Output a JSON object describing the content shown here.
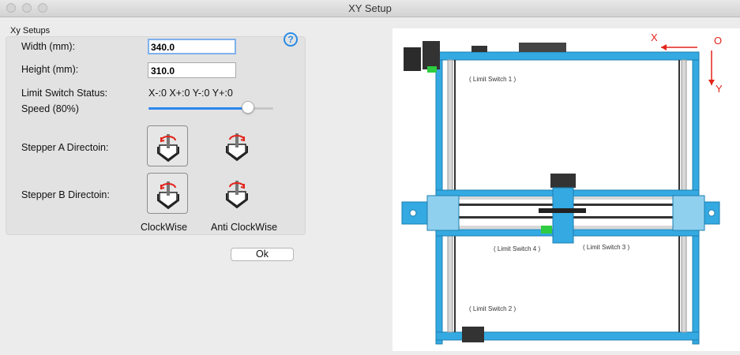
{
  "window": {
    "title": "XY Setup"
  },
  "group": {
    "label": "Xy Setups"
  },
  "help": {
    "symbol": "?"
  },
  "width": {
    "label": "Width (mm):",
    "value": "340.0"
  },
  "height": {
    "label": "Height (mm):",
    "value": "310.0"
  },
  "limit_switch": {
    "label": "Limit Switch Status:",
    "value": "X-:0 X+:0 Y-:0 Y+:0"
  },
  "speed": {
    "label": "Speed (80%)",
    "level": 0.8
  },
  "stepper_a": {
    "label": "Stepper A Directoin:",
    "selected": "ClockWise"
  },
  "stepper_b": {
    "label": "Stepper B Directoin:",
    "selected": "ClockWise"
  },
  "direction_options": {
    "clockwise": "ClockWise",
    "anti_clockwise": "Anti ClockWise"
  },
  "ok_button": {
    "label": "Ok"
  },
  "diagram": {
    "axis_x": "X",
    "axis_y": "Y",
    "origin": "O",
    "limit_switch_1": "( Limit Switch 1 )",
    "limit_switch_2": "( Limit Switch 2 )",
    "limit_switch_3": "( Limit Switch 3 )",
    "limit_switch_4": "( Limit Switch 4 )"
  },
  "colors": {
    "frame_blue": "#34a9e2",
    "accent": "#2a86f0",
    "axis_red": "#e2231a"
  }
}
